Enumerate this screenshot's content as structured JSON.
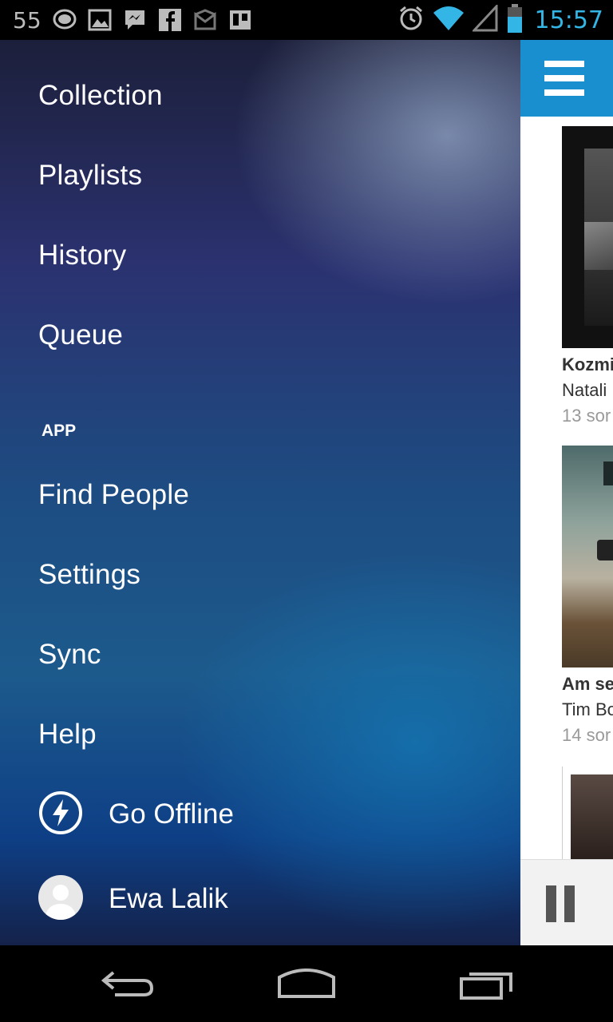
{
  "status_bar": {
    "left_number": "55",
    "time": "15:57",
    "icons": [
      "chat-bubble-icon",
      "image-icon",
      "messenger-icon",
      "facebook-icon",
      "gmail-icon",
      "trello-icon"
    ],
    "right_icons": [
      "alarm-icon",
      "wifi-icon",
      "signal-icon",
      "battery-icon"
    ]
  },
  "drawer": {
    "items": [
      {
        "label": "Collection"
      },
      {
        "label": "Playlists"
      },
      {
        "label": "History"
      },
      {
        "label": "Queue"
      }
    ],
    "section_label": "APP",
    "app_items": [
      {
        "label": "Find People"
      },
      {
        "label": "Settings"
      },
      {
        "label": "Sync"
      },
      {
        "label": "Help"
      }
    ],
    "go_offline": {
      "label": "Go Offline",
      "icon": "lightning-bolt-icon"
    },
    "user": {
      "label": "Ewa Lalik",
      "icon": "avatar-icon"
    }
  },
  "content": {
    "albums": [
      {
        "title": "Kozmi",
        "artist": "Natali",
        "songs": "13 sor"
      },
      {
        "title": "Am se",
        "artist": "Tim Bo",
        "songs": "14 sor"
      }
    ]
  },
  "colors": {
    "accent": "#1a8fcf",
    "time": "#33b5e5"
  }
}
